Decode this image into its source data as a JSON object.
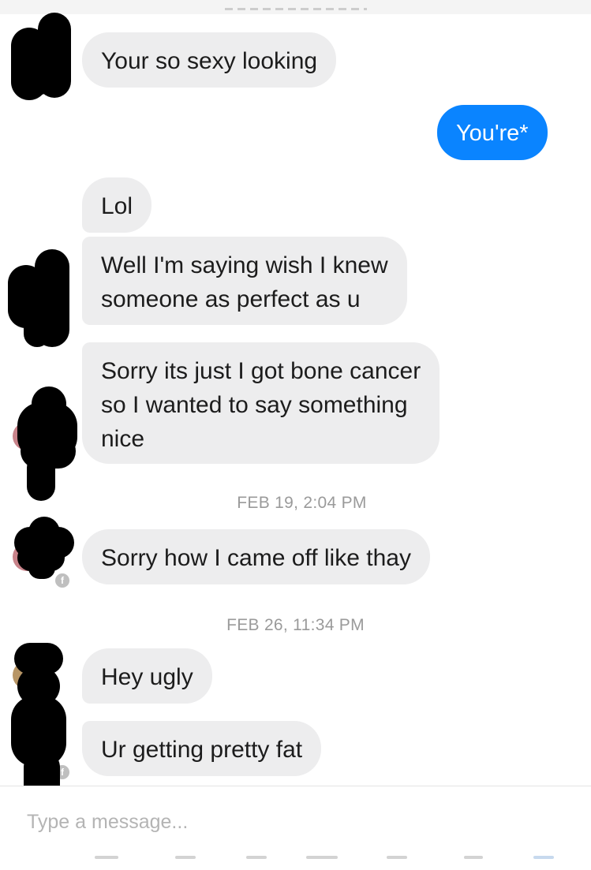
{
  "thread": {
    "messages": [
      {
        "id": "m1",
        "direction": "incoming",
        "lines": [
          "Your so sexy looking"
        ]
      },
      {
        "id": "m2",
        "direction": "outgoing",
        "lines": [
          "You're*"
        ]
      },
      {
        "id": "m3",
        "direction": "incoming",
        "lines": [
          "Lol"
        ]
      },
      {
        "id": "m4",
        "direction": "incoming",
        "lines": [
          "Well I'm saying wish I knew",
          "someone as perfect as u"
        ]
      },
      {
        "id": "m5",
        "direction": "incoming",
        "lines": [
          "Sorry its just I got bone cancer",
          "so I wanted to say something",
          "nice"
        ]
      },
      {
        "id": "m6",
        "direction": "incoming",
        "lines": [
          "Sorry how I came off like thay"
        ]
      },
      {
        "id": "m7",
        "direction": "incoming",
        "lines": [
          "Hey ugly"
        ]
      },
      {
        "id": "m8",
        "direction": "incoming",
        "lines": [
          "Ur getting pretty fat"
        ]
      }
    ],
    "timestamps": [
      "FEB 19, 2:04 PM",
      "FEB 26, 11:34 PM"
    ]
  },
  "composer": {
    "placeholder": "Type a message..."
  },
  "colors": {
    "incoming_bubble": "#ededee",
    "outgoing_bubble": "#0a84ff",
    "timestamp_text": "#9a9a9a"
  }
}
